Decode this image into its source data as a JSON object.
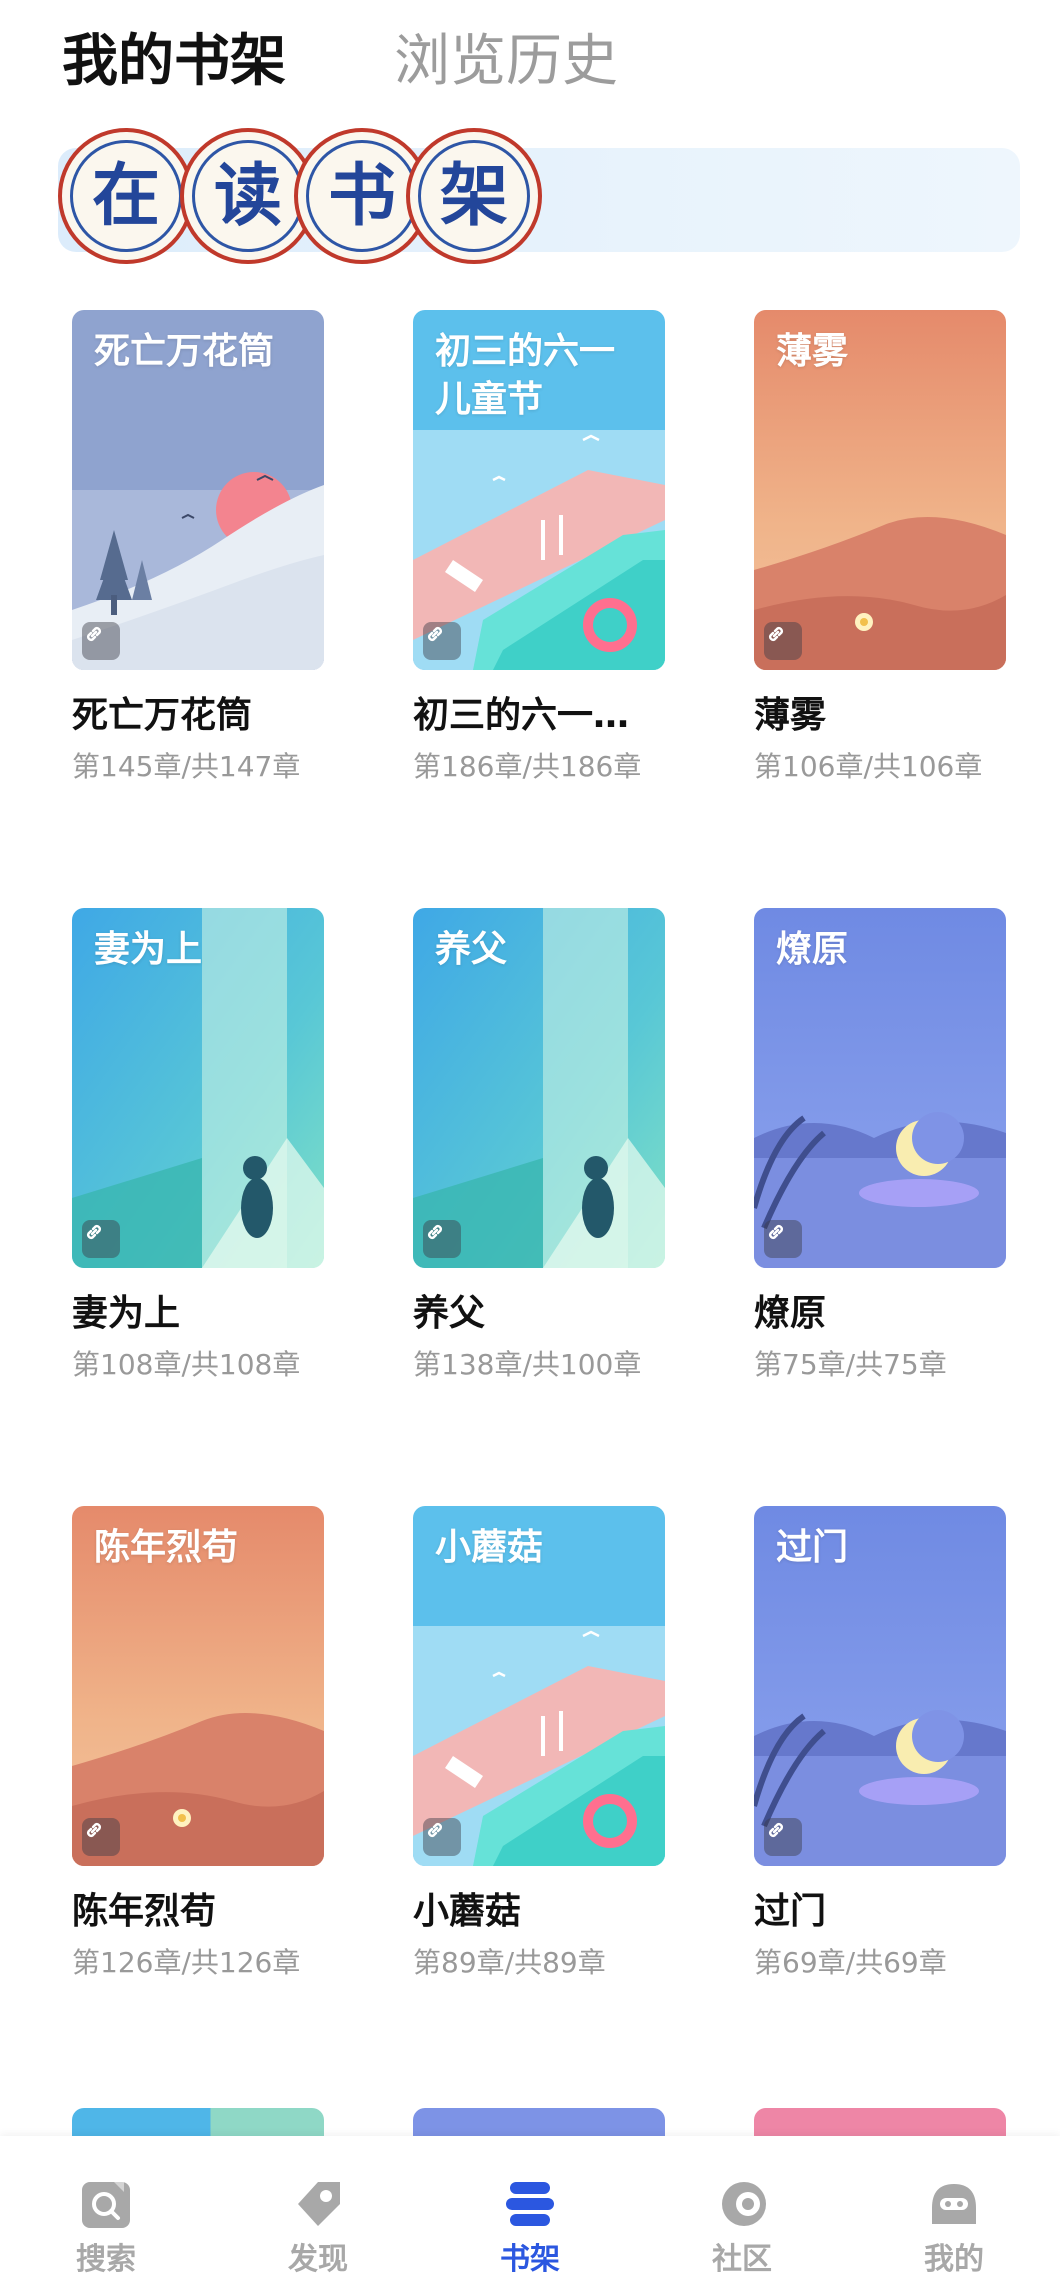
{
  "header": {
    "tabs": [
      {
        "label": "我的书架",
        "active": true
      },
      {
        "label": "浏览历史",
        "active": false
      }
    ]
  },
  "banner": {
    "stamp_chars": [
      "在",
      "读",
      "书",
      "架"
    ]
  },
  "books": [
    {
      "title": "死亡万花筒",
      "cover_title": "死亡万花筒",
      "display_title": "死亡万花筒",
      "progress": "第145章/共147章",
      "cover_theme": "snowy-hill-sunset"
    },
    {
      "title": "初三的六一儿童节",
      "cover_title": "初三的六一儿童节",
      "display_title": "初三的六一…",
      "progress": "第186章/共186章",
      "cover_theme": "pool-summer"
    },
    {
      "title": "薄雾",
      "cover_title": "薄雾",
      "display_title": "薄雾",
      "progress": "第106章/共106章",
      "cover_theme": "desert-dunes"
    },
    {
      "title": "妻为上",
      "cover_title": "妻为上",
      "display_title": "妻为上",
      "progress": "第108章/共108章",
      "cover_theme": "cat-window"
    },
    {
      "title": "养父",
      "cover_title": "养父",
      "display_title": "养父",
      "progress": "第138章/共100章",
      "cover_theme": "cat-window"
    },
    {
      "title": "燎原",
      "cover_title": "燎原",
      "display_title": "燎原",
      "progress": "第75章/共75章",
      "cover_theme": "moon-lake"
    },
    {
      "title": "陈年烈苟",
      "cover_title": "陈年烈苟",
      "display_title": "陈年烈苟",
      "progress": "第126章/共126章",
      "cover_theme": "desert-dunes"
    },
    {
      "title": "小蘑菇",
      "cover_title": "小蘑菇",
      "display_title": "小蘑菇",
      "progress": "第89章/共89章",
      "cover_theme": "pool-summer"
    },
    {
      "title": "过门",
      "cover_title": "过门",
      "display_title": "过门",
      "progress": "第69章/共69章",
      "cover_theme": "moon-lake"
    }
  ],
  "icons": {
    "cover_link": "link-icon"
  },
  "bottom_nav": [
    {
      "label": "搜索",
      "icon": "search-icon",
      "active": false
    },
    {
      "label": "发现",
      "icon": "discover-tag-icon",
      "active": false
    },
    {
      "label": "书架",
      "icon": "bookshelf-icon",
      "active": true
    },
    {
      "label": "社区",
      "icon": "community-icon",
      "active": false
    },
    {
      "label": "我的",
      "icon": "profile-icon",
      "active": false
    }
  ],
  "colors": {
    "nav_active": "#2b57e0",
    "nav_inactive": "#a8a8a8",
    "stamp_red": "#c0392b",
    "stamp_blue": "#23469a"
  }
}
